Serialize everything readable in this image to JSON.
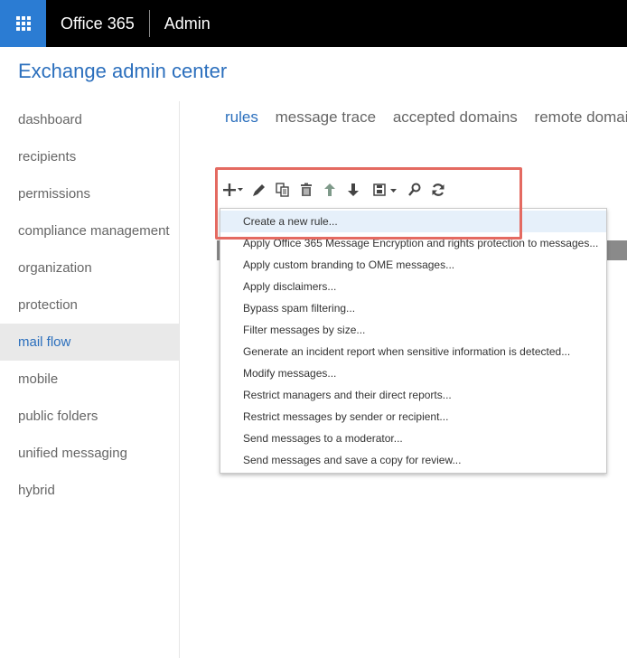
{
  "topbar": {
    "brand": "Office 365",
    "section": "Admin"
  },
  "page": {
    "title": "Exchange admin center"
  },
  "sidebar": {
    "items": [
      {
        "label": "dashboard"
      },
      {
        "label": "recipients"
      },
      {
        "label": "permissions"
      },
      {
        "label": "compliance management"
      },
      {
        "label": "organization"
      },
      {
        "label": "protection"
      },
      {
        "label": "mail flow"
      },
      {
        "label": "mobile"
      },
      {
        "label": "public folders"
      },
      {
        "label": "unified messaging"
      },
      {
        "label": "hybrid"
      }
    ],
    "active": "mail flow"
  },
  "tabs": [
    {
      "label": "rules"
    },
    {
      "label": "message trace"
    },
    {
      "label": "accepted domains"
    },
    {
      "label": "remote domains"
    }
  ],
  "toolbar": {
    "icons": [
      "plus-icon",
      "pencil-icon",
      "copy-icon",
      "trash-icon",
      "arrow-up-icon",
      "arrow-down-icon",
      "save-icon",
      "search-icon",
      "refresh-icon"
    ]
  },
  "dropdown": {
    "items": [
      {
        "label": "Create a new rule..."
      },
      {
        "label": "Apply Office 365 Message Encryption and rights protection to messages..."
      },
      {
        "label": "Apply custom branding to OME messages..."
      },
      {
        "label": "Apply disclaimers..."
      },
      {
        "label": "Bypass spam filtering..."
      },
      {
        "label": "Filter messages by size..."
      },
      {
        "label": "Generate an incident report when sensitive information is detected..."
      },
      {
        "label": "Modify messages..."
      },
      {
        "label": "Restrict managers and their direct reports..."
      },
      {
        "label": "Restrict messages by sender or recipient..."
      },
      {
        "label": "Send messages to a moderator..."
      },
      {
        "label": "Send messages and save a copy for review..."
      }
    ]
  },
  "colors": {
    "accent": "#2b6fbd",
    "waffle": "#2b7cd3",
    "highlight": "#e46a61"
  }
}
